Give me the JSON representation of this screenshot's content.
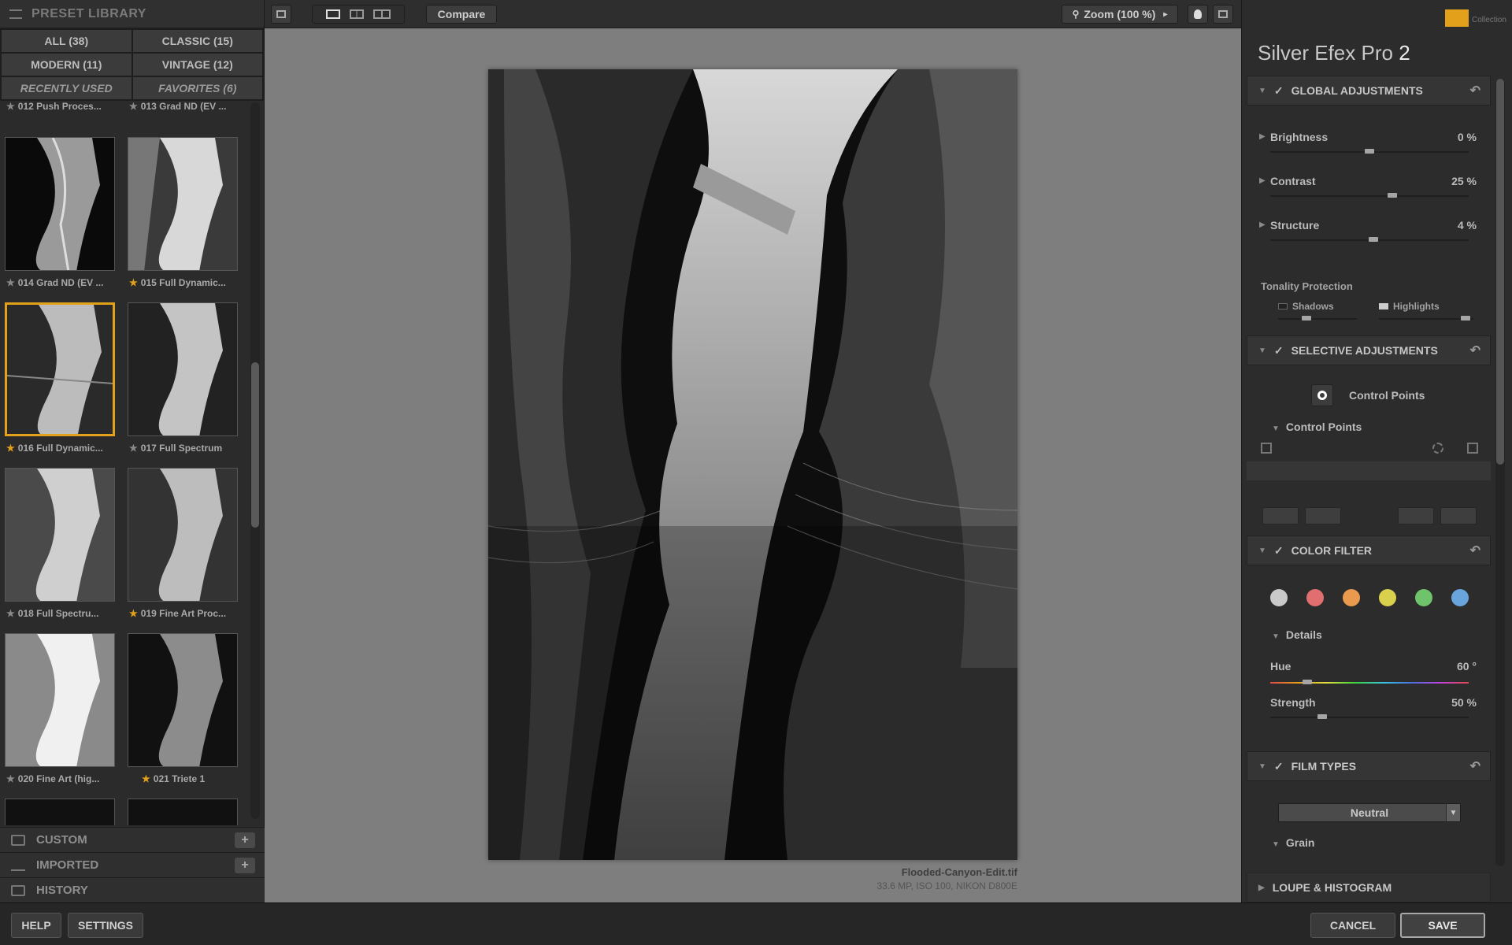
{
  "library": {
    "title": "PRESET LIBRARY",
    "categories": [
      {
        "label": "ALL (38)"
      },
      {
        "label": "CLASSIC (15)"
      },
      {
        "label": "MODERN (11)"
      },
      {
        "label": "VINTAGE (12)"
      },
      {
        "label": "RECENTLY USED"
      },
      {
        "label": "FAVORITES (6)"
      }
    ],
    "presets": [
      {
        "label": "012 Push Proces...",
        "favorite": false
      },
      {
        "label": "013 Grad ND (EV ...",
        "favorite": false
      },
      {
        "label": "014 Grad ND (EV ...",
        "favorite": false
      },
      {
        "label": "015 Full Dynamic...",
        "favorite": true
      },
      {
        "label": "016 Full Dynamic...",
        "favorite": true
      },
      {
        "label": "017 Full Spectrum",
        "favorite": false
      },
      {
        "label": "018 Full Spectru...",
        "favorite": false
      },
      {
        "label": "019 Fine Art Proc...",
        "favorite": true
      },
      {
        "label": "020 Fine Art (hig...",
        "favorite": false
      },
      {
        "label": "021 Triete 1",
        "favorite": true
      }
    ],
    "sections": {
      "custom": "CUSTOM",
      "imported": "IMPORTED",
      "history": "HISTORY"
    }
  },
  "toolbar": {
    "compare": "Compare",
    "zoom": "Zoom (100 %)"
  },
  "image": {
    "filename": "Flooded-Canyon-Edit.tif",
    "meta": "33.6 MP, ISO 100, NIKON D800E"
  },
  "panel": {
    "brand": "Collection",
    "app_name": "Silver Efex Pro",
    "app_version": "2",
    "global": {
      "title": "GLOBAL ADJUSTMENTS",
      "brightness": {
        "label": "Brightness",
        "value": "0 %",
        "level": 0.5
      },
      "contrast": {
        "label": "Contrast",
        "value": "25 %",
        "level": 0.62
      },
      "structure": {
        "label": "Structure",
        "value": "4 %",
        "level": 0.52
      },
      "tonality": "Tonality Protection",
      "shadows": "Shadows",
      "highlights": "Highlights"
    },
    "selective": {
      "title": "SELECTIVE ADJUSTMENTS",
      "control_points_btn": "Control Points",
      "control_points_label": "Control Points"
    },
    "color_filter": {
      "title": "COLOR FILTER",
      "swatches": [
        "#c9c9c9",
        "#e26f6f",
        "#e99a4f",
        "#d9d04e",
        "#6fc36a",
        "#6aa4dd"
      ],
      "details": "Details",
      "hue": {
        "label": "Hue",
        "value": "60 °",
        "level": 0.17
      },
      "strength": {
        "label": "Strength",
        "value": "50 %",
        "level": 0.25
      }
    },
    "film": {
      "title": "FILM TYPES",
      "selected": "Neutral",
      "grain": "Grain"
    },
    "loupe": "LOUPE & HISTOGRAM"
  },
  "bottom": {
    "help": "HELP",
    "settings": "SETTINGS",
    "cancel": "CANCEL",
    "save": "SAVE"
  }
}
